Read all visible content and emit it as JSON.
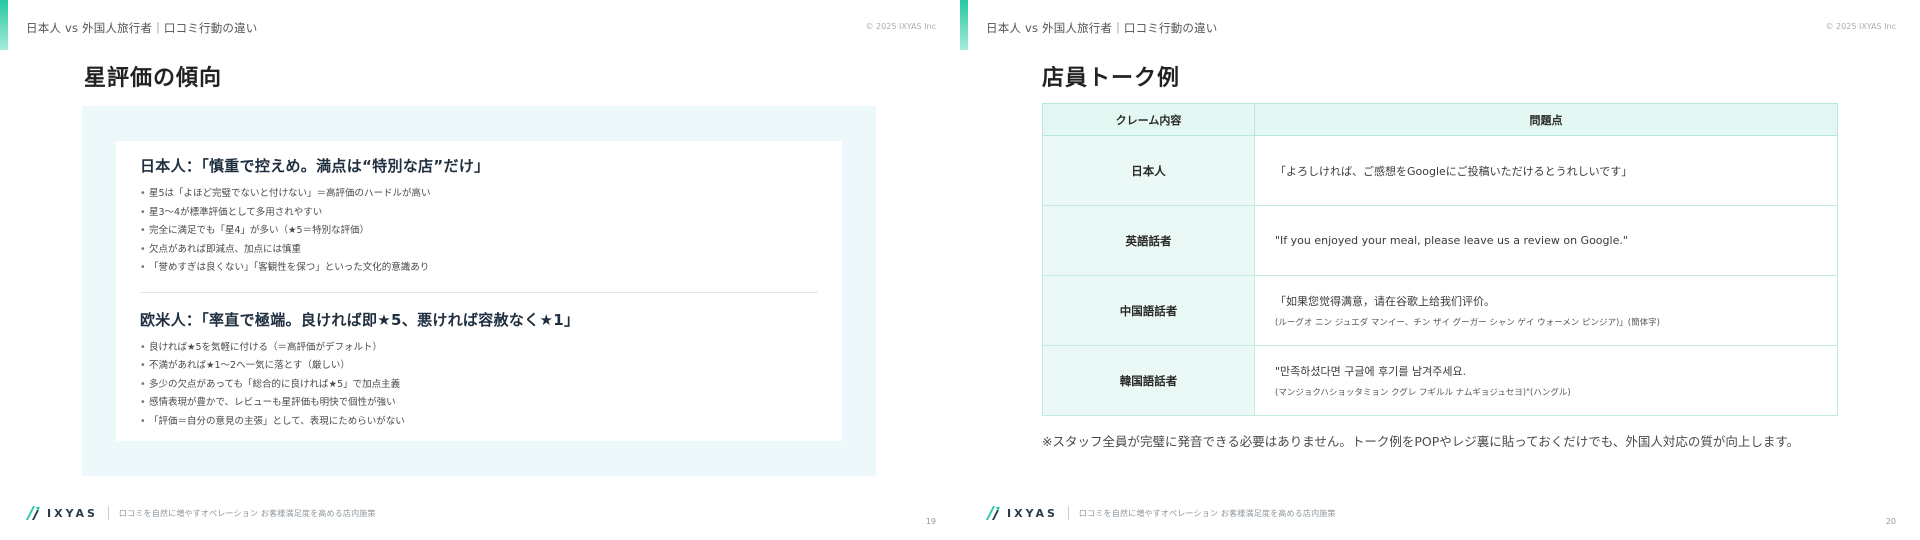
{
  "slides": [
    {
      "header": "日本人 vs 外国人旅行者｜口コミ行動の違い",
      "copyright": "© 2025 IXYAS Inc",
      "title": "星評価の傾向",
      "cards": [
        {
          "heading": "日本人：「慎重で控えめ。満点は“特別な店”だけ」",
          "bullets": [
            "星5は「よほど完璧でないと付けない」＝高評価のハードルが高い",
            "星3〜4が標準評価として多用されやすい",
            "完全に満足でも「星4」が多い（★5＝特別な評価）",
            "欠点があれば即減点、加点には慎重",
            "「誉めすぎは良くない」「客観性を保つ」といった文化的意識あり"
          ]
        },
        {
          "heading": "欧米人：「率直で極端。良ければ即★5、悪ければ容赦なく★1」",
          "bullets": [
            "良ければ★5を気軽に付ける（＝高評価がデフォルト）",
            "不満があれば★1〜2へ一気に落とす（厳しい）",
            "多少の欠点があっても「総合的に良ければ★5」で加点主義",
            "感情表現が豊かで、レビューも星評価も明快で個性が強い",
            "「評価＝自分の意見の主張」として、表現にためらいがない"
          ]
        }
      ],
      "footer": {
        "logo": "IXYAS",
        "text": "口コミを自然に増やすオペレーション お客様満足度を高める店内施策"
      },
      "page": "19"
    },
    {
      "header": "日本人 vs 外国人旅行者｜口コミ行動の違い",
      "copyright": "© 2025 IXYAS Inc",
      "title": "店員トーク例",
      "table": {
        "headers": [
          "クレーム内容",
          "問題点"
        ],
        "rows": [
          {
            "label": "日本人",
            "line1": "「よろしければ、ご感想をGoogleにご投稿いただけるとうれしいです」",
            "line2": ""
          },
          {
            "label": "英語話者",
            "line1": "\"If you enjoyed your meal, please leave us a review on Google.\"",
            "line2": ""
          },
          {
            "label": "中国語話者",
            "line1": "「如果您觉得满意，请在谷歌上给我们评价。",
            "line2": "(ルーグオ ニン ジュエダ マンイー、チン ザイ グーガー シャン ゲイ ウォーメン ピンジア)」(簡体字)"
          },
          {
            "label": "韓国語話者",
            "line1": "\"만족하셨다면 구글에 후기를 남겨주세요.",
            "line2": "(マンジョクハショッタミョン クグレ フギルル ナムギョジュセヨ)\"(ハングル)"
          }
        ]
      },
      "note": "※スタッフ全員が完璧に発音できる必要はありません。トーク例をPOPやレジ裏に貼っておくだけでも、外国人対応の質が向上します。",
      "footer": {
        "logo": "IXYAS",
        "text": "口コミを自然に増やすオペレーション お客様満足度を高める店内施策"
      },
      "page": "20"
    }
  ],
  "colors": {
    "accent": "#25c7a0",
    "panel_bg": "#ecf8fa",
    "table_header_bg": "#e3f7f3",
    "table_border": "#c3eae1"
  },
  "icons": [
    "ixyas-logo-icon"
  ]
}
